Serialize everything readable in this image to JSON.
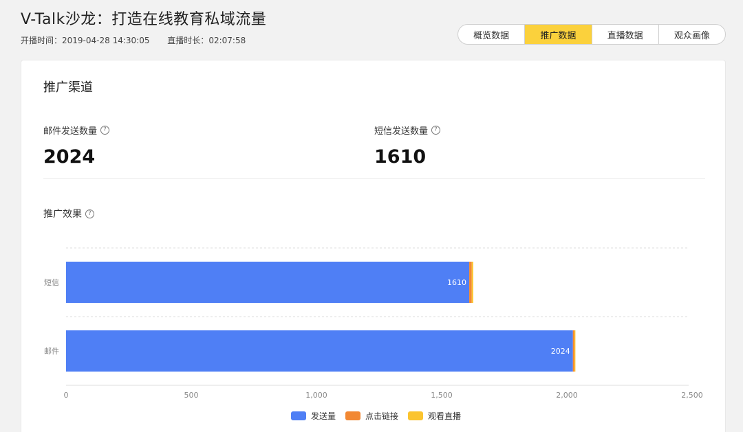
{
  "header": {
    "title": "V-Talk沙龙：打造在线教育私域流量",
    "start_label": "开播时间：",
    "start_time": "2019-04-28 14:30:05",
    "duration_label": "直播时长：",
    "duration": "02:07:58"
  },
  "tabs": [
    {
      "label": "概览数据",
      "active": false
    },
    {
      "label": "推广数据",
      "active": true
    },
    {
      "label": "直播数据",
      "active": false
    },
    {
      "label": "观众画像",
      "active": false
    }
  ],
  "section": {
    "title": "推广渠道",
    "email_label": "邮件发送数量",
    "email_value": "2024",
    "sms_label": "短信发送数量",
    "sms_value": "1610",
    "effect_title": "推广效果"
  },
  "colors": {
    "active_tab": "#fbd13c",
    "series_send": "#4f7ff5",
    "series_click": "#f28833",
    "series_watch": "#fbc42f"
  },
  "chart_data": {
    "type": "bar",
    "orientation": "horizontal",
    "stacked": true,
    "categories": [
      "短信",
      "邮件"
    ],
    "series": [
      {
        "name": "发送量",
        "values": [
          1610,
          2024
        ],
        "labels": [
          "1610",
          "2024"
        ]
      },
      {
        "name": "点击链接",
        "values": [
          10,
          6
        ]
      },
      {
        "name": "观看直播",
        "values": [
          6,
          4
        ]
      }
    ],
    "xlim": [
      0,
      2500
    ],
    "xticks": [
      0,
      500,
      1000,
      1500,
      2000,
      2500
    ],
    "xtick_labels": [
      "0",
      "500",
      "1,000",
      "1,500",
      "2,000",
      "2,500"
    ],
    "grid": "dashed-horizontal",
    "legend": "bottom"
  }
}
